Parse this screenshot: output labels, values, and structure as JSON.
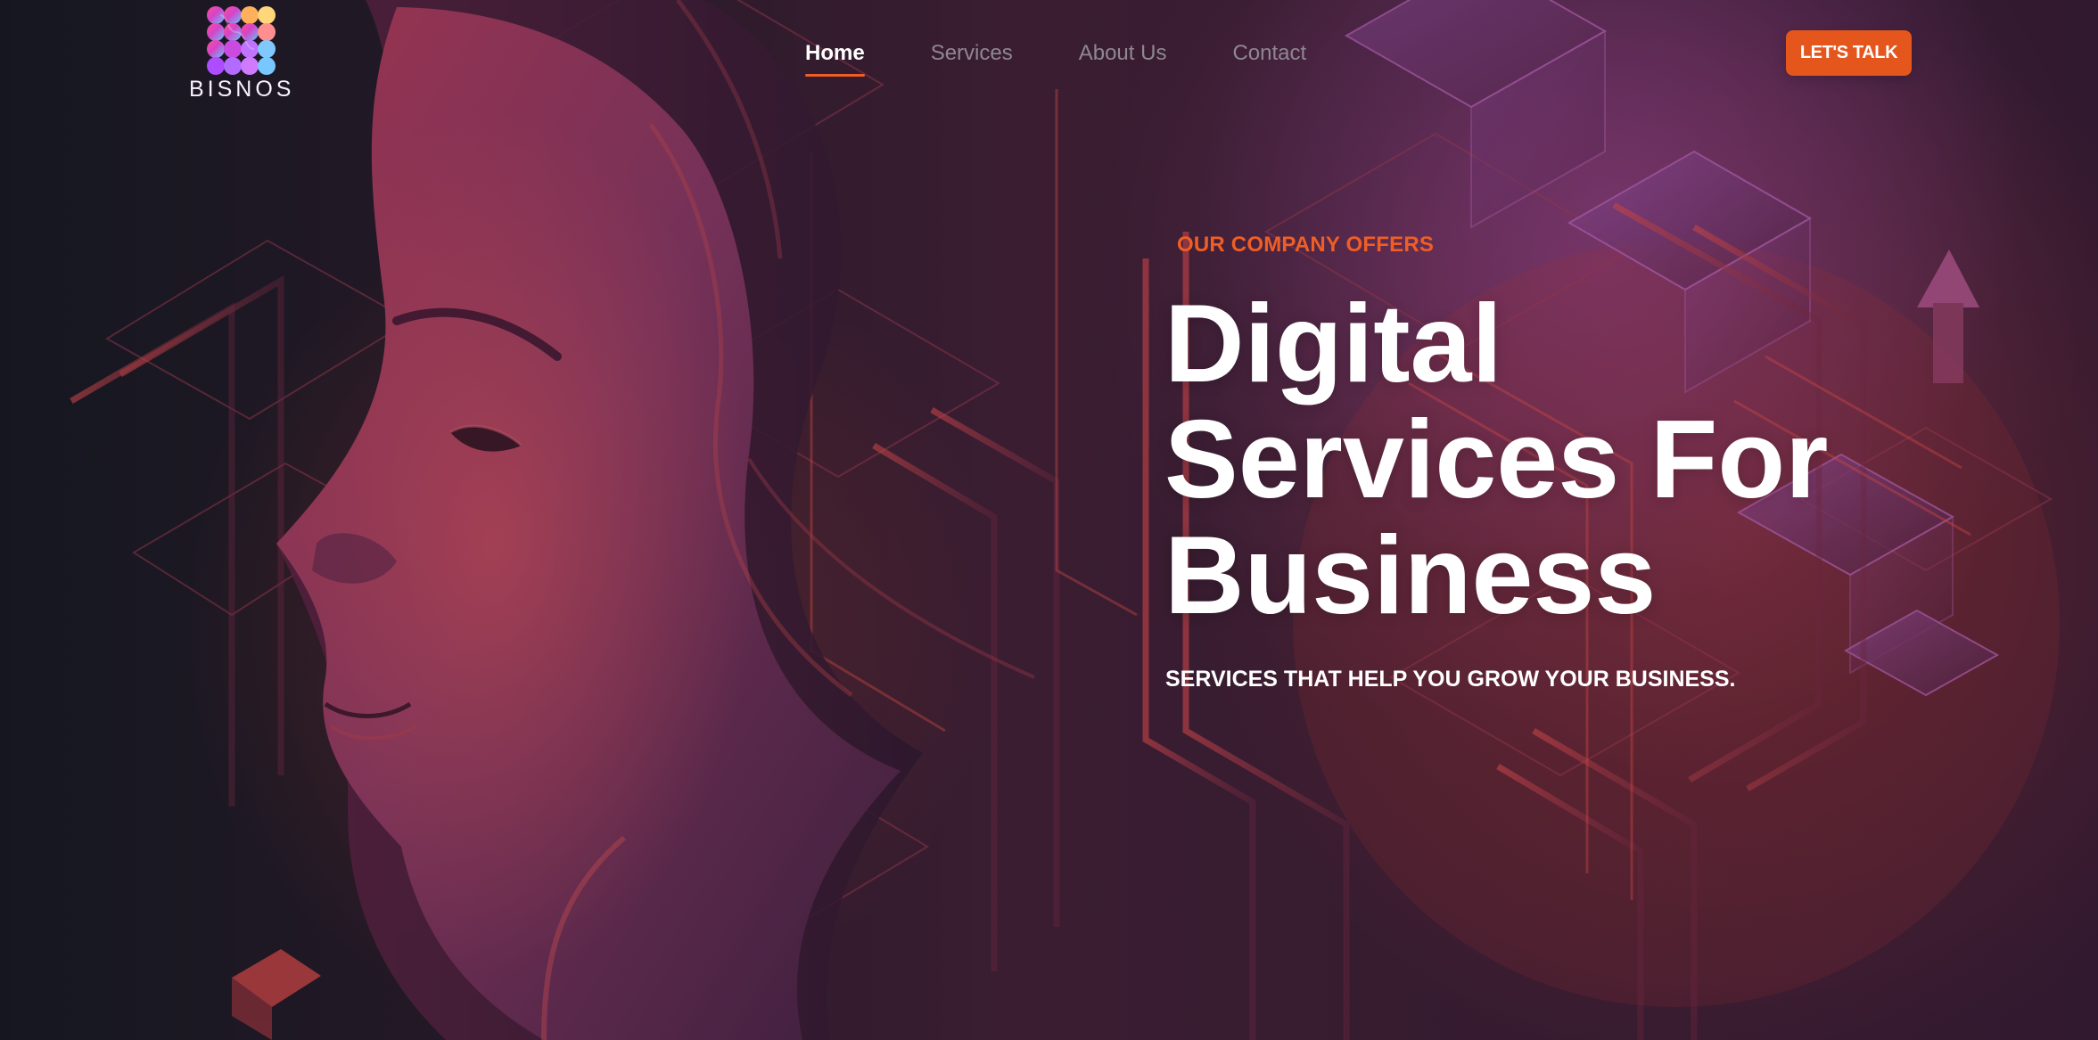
{
  "brand": {
    "logo_text": "BISNOS",
    "icon": "bisnos-logo-icon"
  },
  "navigation": {
    "items": [
      {
        "label": "Home",
        "state": "active"
      },
      {
        "label": "Services",
        "state": "inactive"
      },
      {
        "label": "About Us",
        "state": "inactive"
      },
      {
        "label": "Contact",
        "state": "inactive"
      }
    ]
  },
  "header": {
    "cta_label": "LET'S TALK"
  },
  "hero": {
    "eyebrow": "OUR COMPANY OFFERS",
    "headline": {
      "line_1": "Digital",
      "line_2": "Services For",
      "line_3": "Business"
    },
    "subtitle": "SERVICES THAT HELP YOU GROW YOUR BUSINESS."
  },
  "colors": {
    "accent": "#E5561D",
    "headline": "#FFFFFF",
    "nav_inactive": "#8F8791",
    "background": "#2A1A2B"
  }
}
